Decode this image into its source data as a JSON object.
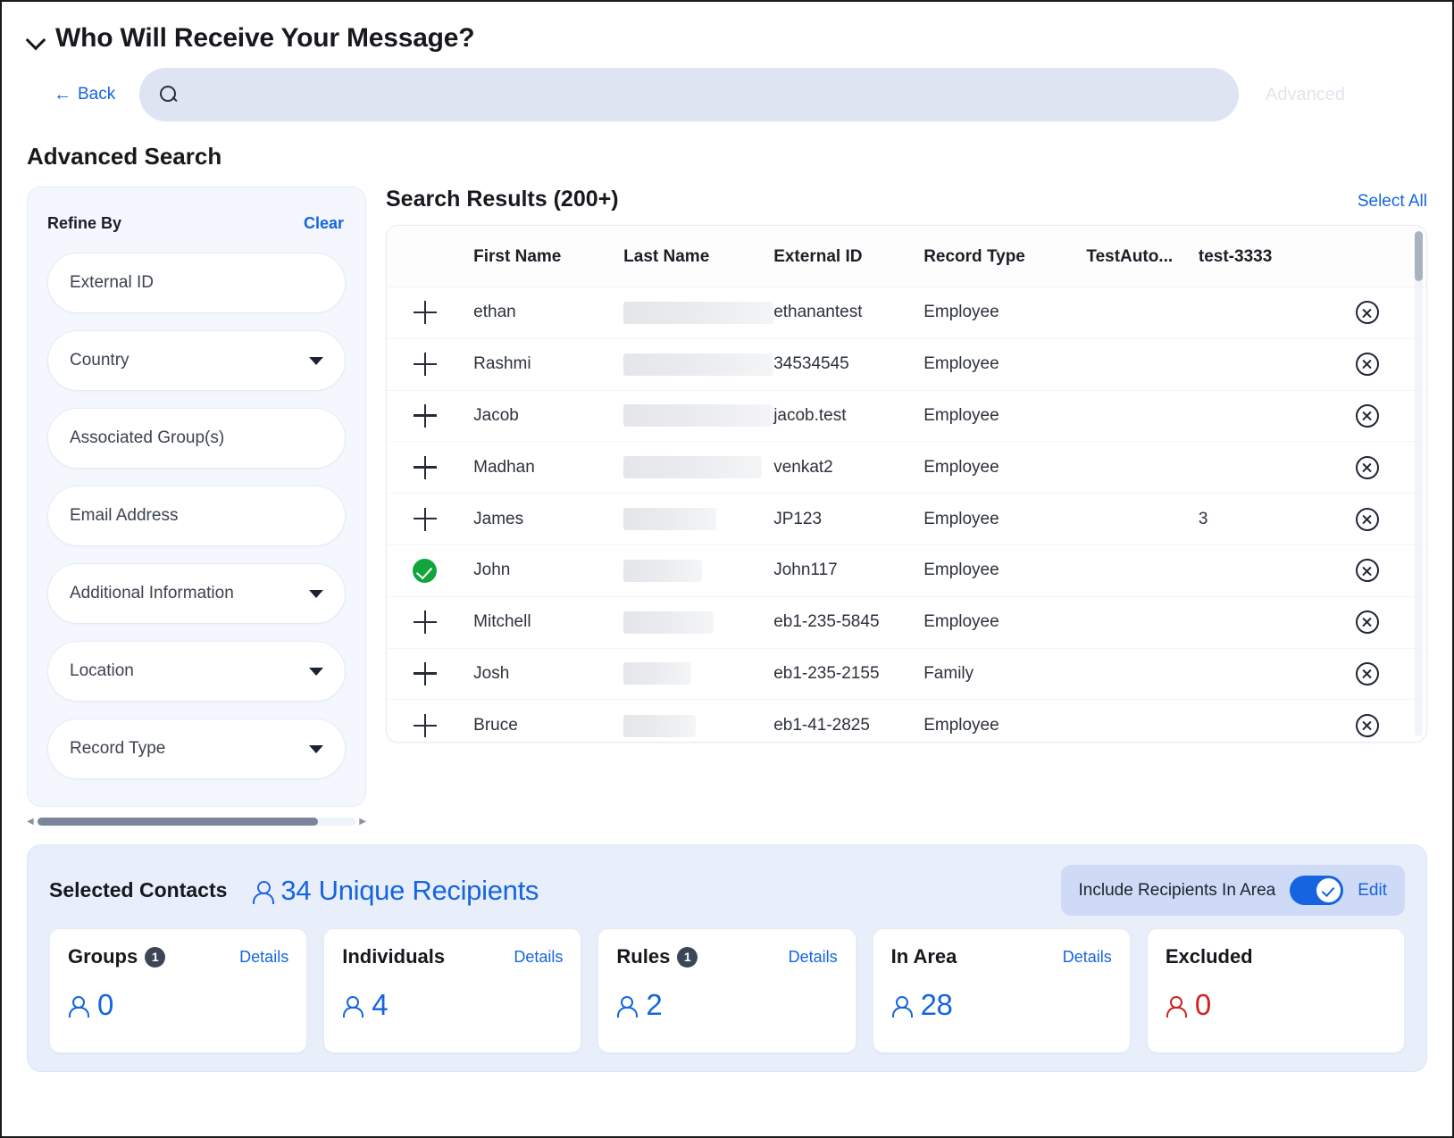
{
  "header": {
    "title": "Who Will Receive Your Message?",
    "collapse_icon": "chevron-down-icon"
  },
  "search": {
    "back_label": "Back",
    "back_arrow": "←",
    "value": "",
    "placeholder": "",
    "search_icon": "search-icon",
    "advanced_label": "Advanced"
  },
  "section": {
    "title": "Advanced Search"
  },
  "sidebar": {
    "refine_title": "Refine By",
    "clear_label": "Clear",
    "fields": [
      {
        "label": "External ID",
        "has_caret": false
      },
      {
        "label": "Country",
        "has_caret": true
      },
      {
        "label": "Associated Group(s)",
        "has_caret": false
      },
      {
        "label": "Email Address",
        "has_caret": false
      },
      {
        "label": "Additional Information",
        "has_caret": true
      },
      {
        "label": "Location",
        "has_caret": true
      },
      {
        "label": "Record Type",
        "has_caret": true
      }
    ]
  },
  "results": {
    "title": "Search Results (200+)",
    "select_all_label": "Select All",
    "columns": [
      "",
      "First Name",
      "Last Name",
      "External ID",
      "Record Type",
      "TestAuto...",
      "test-3333",
      ""
    ],
    "rows": [
      {
        "state": "unselected",
        "first_name": "ethan",
        "last_name": "",
        "external_id": "ethanantest",
        "record_type": "Employee",
        "testauto": "",
        "test3333": ""
      },
      {
        "state": "unselected",
        "first_name": "Rashmi",
        "last_name": "",
        "external_id": "34534545",
        "record_type": "Employee",
        "testauto": "",
        "test3333": ""
      },
      {
        "state": "unselected",
        "first_name": "Jacob",
        "last_name": "",
        "external_id": "jacob.test",
        "record_type": "Employee",
        "testauto": "",
        "test3333": ""
      },
      {
        "state": "unselected",
        "first_name": "Madhan",
        "last_name": "",
        "external_id": "venkat2",
        "record_type": "Employee",
        "testauto": "",
        "test3333": ""
      },
      {
        "state": "unselected",
        "first_name": "James",
        "last_name": "",
        "external_id": "JP123",
        "record_type": "Employee",
        "testauto": "",
        "test3333": "3"
      },
      {
        "state": "selected",
        "first_name": "John",
        "last_name": "",
        "external_id": "John117",
        "record_type": "Employee",
        "testauto": "",
        "test3333": ""
      },
      {
        "state": "unselected",
        "first_name": "Mitchell",
        "last_name": "",
        "external_id": "eb1-235-5845",
        "record_type": "Employee",
        "testauto": "",
        "test3333": ""
      },
      {
        "state": "unselected",
        "first_name": "Josh",
        "last_name": "",
        "external_id": "eb1-235-2155",
        "record_type": "Family",
        "testauto": "",
        "test3333": ""
      },
      {
        "state": "unselected",
        "first_name": "Bruce",
        "last_name": "",
        "external_id": "eb1-41-2825",
        "record_type": "Employee",
        "testauto": "",
        "test3333": ""
      }
    ]
  },
  "selected_contacts": {
    "label": "Selected Contacts",
    "recipients_text": "34 Unique Recipients",
    "toggle": {
      "label": "Include Recipients In Area",
      "on": true,
      "edit_label": "Edit"
    },
    "cards": [
      {
        "title": "Groups",
        "badge": "1",
        "details_label": "Details",
        "value": "0",
        "color": "blue"
      },
      {
        "title": "Individuals",
        "badge": "",
        "details_label": "Details",
        "value": "4",
        "color": "blue"
      },
      {
        "title": "Rules",
        "badge": "1",
        "details_label": "Details",
        "value": "2",
        "color": "blue"
      },
      {
        "title": "In Area",
        "badge": "",
        "details_label": "Details",
        "value": "28",
        "color": "blue"
      },
      {
        "title": "Excluded",
        "badge": "",
        "details_label": "",
        "value": "0",
        "color": "red"
      }
    ]
  },
  "colors": {
    "accent": "#1565e0",
    "selected_green": "#11a63d",
    "excluded_red": "#cf2222",
    "panel_bg": "#e9eefb"
  }
}
